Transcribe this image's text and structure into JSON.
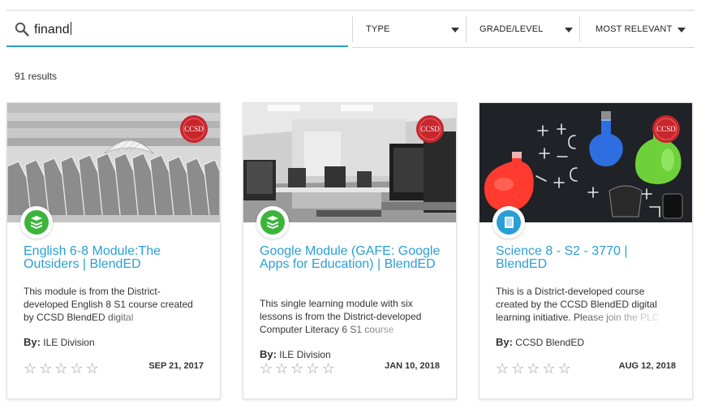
{
  "search": {
    "value": "finand",
    "icon": "search-icon"
  },
  "filters": [
    {
      "label": "TYPE"
    },
    {
      "label": "GRADE/LEVEL"
    },
    {
      "label": "MOST RELEVANT"
    }
  ],
  "results_count": "91 results",
  "colors": {
    "accent": "#2a9fd6",
    "badge_green": "#3cb43c",
    "badge_blue": "#2a9fd6",
    "seal_red": "#c8252c"
  },
  "cards": [
    {
      "title": "English 6-8 Module:The Outsiders | BlendED",
      "description": "This module is from the District-developed English 8 S1 course created by CCSD BlendED digital",
      "by_label": "By:",
      "author": "ILE Division",
      "date": "SEP 21, 2017",
      "seal": "CCSD",
      "badge_icon": "stack-icon",
      "rating": 0
    },
    {
      "title": "Google Module (GAFE: Google Apps for Education) | BlendED",
      "description": "This single learning module with six lessons is from the District-developed Computer Literacy 6 S1 course",
      "by_label": "By:",
      "author": "ILE Division",
      "date": "JAN 10, 2018",
      "seal": "CCSD",
      "badge_icon": "stack-icon",
      "rating": 0
    },
    {
      "title": "Science 8 - S2 - 3770 | BlendED",
      "description": "This is a District-developed course created by the CCSD BlendED digital learning initiative. Please join the PLC",
      "by_label": "By:",
      "author": "CCSD BlendED",
      "date": "AUG 12, 2018",
      "seal": "CCSD",
      "badge_icon": "book-icon",
      "rating": 0
    }
  ]
}
